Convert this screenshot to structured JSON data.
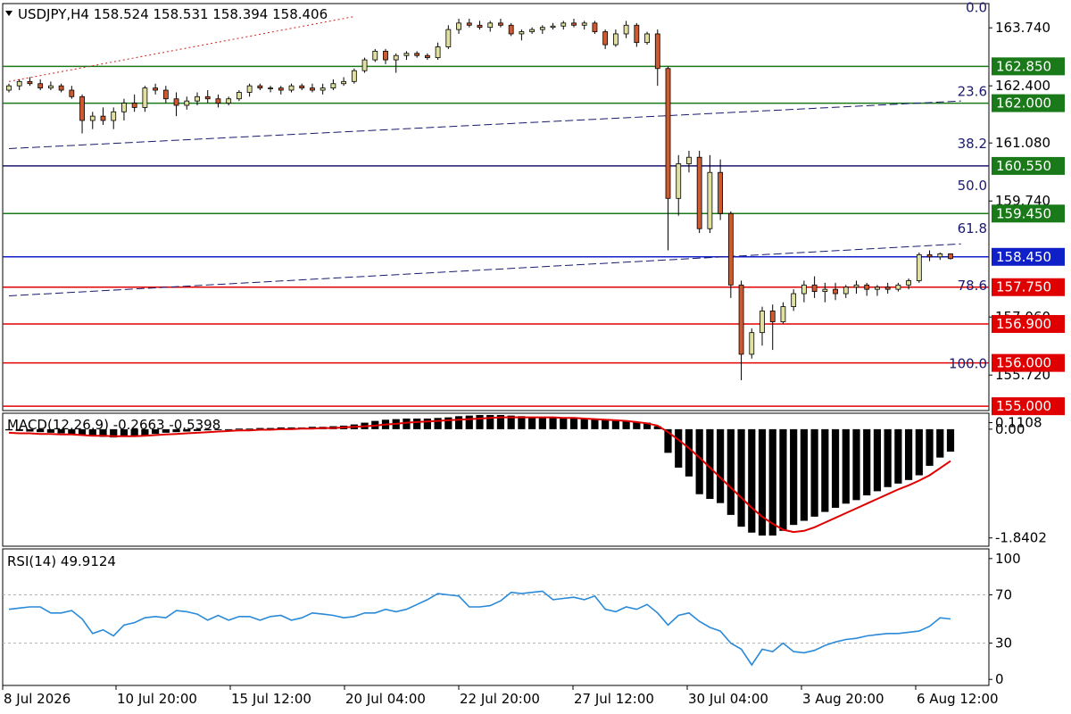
{
  "chart_data": [
    {
      "type": "candlestick",
      "header": {
        "symbol": "USDJPY,H4",
        "ohlc": "158.524 158.531 158.394 158.406"
      },
      "ylim": [
        154.9,
        164.3
      ],
      "y_ticks": [
        "163.740",
        "162.400",
        "161.080",
        "159.740",
        "157.060",
        "155.720"
      ],
      "y_tick_values": [
        163.74,
        162.4,
        161.08,
        159.74,
        157.06,
        155.72
      ],
      "price_badges": [
        {
          "label": "162.850",
          "value": 162.85,
          "color": "#1a7a1a"
        },
        {
          "label": "162.000",
          "value": 162.0,
          "color": "#1a7a1a"
        },
        {
          "label": "160.550",
          "value": 160.55,
          "color": "#1a7a1a"
        },
        {
          "label": "159.450",
          "value": 159.45,
          "color": "#1a7a1a"
        },
        {
          "label": "158.450",
          "value": 158.45,
          "color": "#1020c8"
        },
        {
          "label": "157.750",
          "value": 157.75,
          "color": "#e00000"
        },
        {
          "label": "156.900",
          "value": 156.9,
          "color": "#e00000"
        },
        {
          "label": "156.000",
          "value": 156.0,
          "color": "#e00000"
        },
        {
          "label": "155.000",
          "value": 155.0,
          "color": "#e00000"
        }
      ],
      "horizontal_lines": [
        {
          "value": 162.85,
          "color": "#1a7a1a"
        },
        {
          "value": 162.0,
          "color": "#1a7a1a"
        },
        {
          "value": 160.55,
          "color": "#1a1a6e"
        },
        {
          "value": 159.45,
          "color": "#1a7a1a"
        },
        {
          "value": 158.45,
          "color": "#1020c8"
        },
        {
          "value": 157.75,
          "color": "#e00000"
        },
        {
          "value": 156.9,
          "color": "#e00000"
        },
        {
          "value": 156.0,
          "color": "#e00000"
        },
        {
          "value": 155.0,
          "color": "#e00000"
        }
      ],
      "fibonacci": [
        {
          "label": "0.0",
          "value": 164.02
        },
        {
          "label": "23.6",
          "value": 162.08
        },
        {
          "label": "38.2",
          "value": 160.88
        },
        {
          "label": "50.0",
          "value": 159.91
        },
        {
          "label": "61.8",
          "value": 158.92
        },
        {
          "label": "78.6",
          "value": 157.6
        },
        {
          "label": "100.0",
          "value": 155.8
        }
      ],
      "candles": [
        [
          162.3,
          162.45,
          162.25,
          162.4
        ],
        [
          162.4,
          162.55,
          162.3,
          162.5
        ],
        [
          162.5,
          162.6,
          162.4,
          162.45
        ],
        [
          162.45,
          162.55,
          162.3,
          162.35
        ],
        [
          162.35,
          162.5,
          162.3,
          162.4
        ],
        [
          162.4,
          162.45,
          162.25,
          162.3
        ],
        [
          162.3,
          162.4,
          162.1,
          162.15
        ],
        [
          162.15,
          162.2,
          161.3,
          161.6
        ],
        [
          161.6,
          161.8,
          161.4,
          161.7
        ],
        [
          161.7,
          161.9,
          161.5,
          161.6
        ],
        [
          161.6,
          161.9,
          161.4,
          161.8
        ],
        [
          161.8,
          162.1,
          161.6,
          162.0
        ],
        [
          162.0,
          162.2,
          161.8,
          161.9
        ],
        [
          161.9,
          162.4,
          161.8,
          162.35
        ],
        [
          162.35,
          162.45,
          162.2,
          162.3
        ],
        [
          162.3,
          162.4,
          162.0,
          162.1
        ],
        [
          162.1,
          162.25,
          161.7,
          161.95
        ],
        [
          161.95,
          162.15,
          161.85,
          162.05
        ],
        [
          162.05,
          162.25,
          161.95,
          162.15
        ],
        [
          162.15,
          162.3,
          162.0,
          162.1
        ],
        [
          162.1,
          162.2,
          161.9,
          162.0
        ],
        [
          162.0,
          162.15,
          161.95,
          162.1
        ],
        [
          162.1,
          162.3,
          162.05,
          162.25
        ],
        [
          162.25,
          162.45,
          162.15,
          162.4
        ],
        [
          162.4,
          162.45,
          162.3,
          162.35
        ],
        [
          162.35,
          162.4,
          162.25,
          162.35
        ],
        [
          162.35,
          162.4,
          162.2,
          162.3
        ],
        [
          162.3,
          162.45,
          162.25,
          162.4
        ],
        [
          162.4,
          162.45,
          162.3,
          162.35
        ],
        [
          162.35,
          162.45,
          162.25,
          162.3
        ],
        [
          162.3,
          162.45,
          162.2,
          162.35
        ],
        [
          162.35,
          162.55,
          162.3,
          162.45
        ],
        [
          162.45,
          162.6,
          162.4,
          162.5
        ],
        [
          162.5,
          162.8,
          162.45,
          162.75
        ],
        [
          162.75,
          163.05,
          162.7,
          163.0
        ],
        [
          163.0,
          163.25,
          162.95,
          163.2
        ],
        [
          163.2,
          163.25,
          162.9,
          163.0
        ],
        [
          163.0,
          163.15,
          162.7,
          163.1
        ],
        [
          163.1,
          163.2,
          163.0,
          163.15
        ],
        [
          163.15,
          163.2,
          163.05,
          163.1
        ],
        [
          163.1,
          163.15,
          163.0,
          163.05
        ],
        [
          163.05,
          163.4,
          163.0,
          163.3
        ],
        [
          163.3,
          163.8,
          163.25,
          163.7
        ],
        [
          163.7,
          163.95,
          163.6,
          163.85
        ],
        [
          163.85,
          163.95,
          163.75,
          163.8
        ],
        [
          163.8,
          163.9,
          163.7,
          163.75
        ],
        [
          163.75,
          163.9,
          163.65,
          163.85
        ],
        [
          163.85,
          163.95,
          163.75,
          163.8
        ],
        [
          163.8,
          163.85,
          163.55,
          163.6
        ],
        [
          163.6,
          163.7,
          163.45,
          163.65
        ],
        [
          163.65,
          163.75,
          163.6,
          163.7
        ],
        [
          163.7,
          163.8,
          163.6,
          163.75
        ],
        [
          163.75,
          163.85,
          163.7,
          163.78
        ],
        [
          163.78,
          163.9,
          163.7,
          163.85
        ],
        [
          163.85,
          163.95,
          163.75,
          163.8
        ],
        [
          163.8,
          163.9,
          163.7,
          163.85
        ],
        [
          163.85,
          163.9,
          163.6,
          163.65
        ],
        [
          163.65,
          163.7,
          163.25,
          163.35
        ],
        [
          163.35,
          163.7,
          163.3,
          163.6
        ],
        [
          163.6,
          163.9,
          163.5,
          163.8
        ],
        [
          163.8,
          163.85,
          163.3,
          163.4
        ],
        [
          163.4,
          163.65,
          163.35,
          163.6
        ],
        [
          163.6,
          163.7,
          162.4,
          162.8
        ],
        [
          162.8,
          162.85,
          158.6,
          159.8
        ],
        [
          159.8,
          160.8,
          159.4,
          160.6
        ],
        [
          160.6,
          160.9,
          160.4,
          160.75
        ],
        [
          160.75,
          160.9,
          159.0,
          159.1
        ],
        [
          159.1,
          160.8,
          159.0,
          160.4
        ],
        [
          160.4,
          160.7,
          159.3,
          159.45
        ],
        [
          159.45,
          159.5,
          157.5,
          157.8
        ],
        [
          157.8,
          157.9,
          155.6,
          156.2
        ],
        [
          156.2,
          156.8,
          156.1,
          156.7
        ],
        [
          156.7,
          157.3,
          156.4,
          157.2
        ],
        [
          157.2,
          157.35,
          156.3,
          156.95
        ],
        [
          156.95,
          157.4,
          156.9,
          157.3
        ],
        [
          157.3,
          157.7,
          157.2,
          157.6
        ],
        [
          157.6,
          157.9,
          157.4,
          157.8
        ],
        [
          157.8,
          158.0,
          157.5,
          157.65
        ],
        [
          157.65,
          157.85,
          157.4,
          157.7
        ],
        [
          157.7,
          157.85,
          157.45,
          157.6
        ],
        [
          157.6,
          157.8,
          157.5,
          157.75
        ],
        [
          157.75,
          157.9,
          157.6,
          157.8
        ],
        [
          157.8,
          157.85,
          157.55,
          157.7
        ],
        [
          157.7,
          157.8,
          157.55,
          157.75
        ],
        [
          157.75,
          157.85,
          157.6,
          157.7
        ],
        [
          157.7,
          157.85,
          157.65,
          157.8
        ],
        [
          157.8,
          157.95,
          157.7,
          157.9
        ],
        [
          157.9,
          158.55,
          157.85,
          158.5
        ],
        [
          158.5,
          158.6,
          158.35,
          158.45
        ],
        [
          158.45,
          158.55,
          158.38,
          158.52
        ],
        [
          158.52,
          158.53,
          158.39,
          158.41
        ]
      ],
      "trendlines": [
        {
          "style": "dotted",
          "color": "#d02020",
          "from": [
            0,
            162.5
          ],
          "to": [
            33,
            164.0
          ]
        },
        {
          "style": "dashed",
          "color": "#1a1a6e",
          "from": [
            0,
            160.95
          ],
          "to": [
            91,
            162.05
          ]
        },
        {
          "style": "dashed",
          "color": "#1a1a6e",
          "from": [
            0,
            157.55
          ],
          "to": [
            91,
            158.75
          ]
        }
      ]
    },
    {
      "type": "bar",
      "header": "MACD(12,26,9) -0.2663 -0.5398",
      "ylim": [
        -1.98,
        0.27
      ],
      "y_ticks": [
        "0.1108",
        "0.00",
        "-1.8402"
      ],
      "y_tick_values": [
        0.1108,
        0.0,
        -1.8402
      ],
      "histogram": [
        -0.02,
        -0.03,
        -0.04,
        -0.05,
        -0.06,
        -0.07,
        -0.08,
        -0.1,
        -0.12,
        -0.13,
        -0.14,
        -0.13,
        -0.12,
        -0.1,
        -0.08,
        -0.06,
        -0.05,
        -0.04,
        -0.03,
        -0.02,
        -0.01,
        0.0,
        0.01,
        0.01,
        0.02,
        0.02,
        0.03,
        0.03,
        0.03,
        0.04,
        0.04,
        0.05,
        0.06,
        0.08,
        0.11,
        0.14,
        0.16,
        0.17,
        0.18,
        0.18,
        0.18,
        0.19,
        0.2,
        0.22,
        0.23,
        0.24,
        0.24,
        0.24,
        0.23,
        0.22,
        0.21,
        0.2,
        0.19,
        0.18,
        0.18,
        0.18,
        0.17,
        0.15,
        0.14,
        0.14,
        0.12,
        0.11,
        0.05,
        -0.4,
        -0.65,
        -0.8,
        -1.1,
        -1.18,
        -1.25,
        -1.45,
        -1.65,
        -1.75,
        -1.8,
        -1.8,
        -1.72,
        -1.62,
        -1.55,
        -1.48,
        -1.4,
        -1.33,
        -1.26,
        -1.2,
        -1.12,
        -1.05,
        -0.98,
        -0.92,
        -0.86,
        -0.78,
        -0.62,
        -0.48,
        -0.38
      ],
      "signal": [
        -0.06,
        -0.07,
        -0.07,
        -0.08,
        -0.08,
        -0.09,
        -0.09,
        -0.1,
        -0.11,
        -0.11,
        -0.12,
        -0.12,
        -0.12,
        -0.11,
        -0.1,
        -0.09,
        -0.08,
        -0.07,
        -0.06,
        -0.05,
        -0.04,
        -0.03,
        -0.02,
        -0.02,
        -0.01,
        -0.01,
        0.0,
        0.0,
        0.01,
        0.01,
        0.02,
        0.02,
        0.03,
        0.04,
        0.05,
        0.06,
        0.08,
        0.09,
        0.11,
        0.12,
        0.13,
        0.14,
        0.15,
        0.16,
        0.17,
        0.18,
        0.19,
        0.2,
        0.2,
        0.2,
        0.2,
        0.2,
        0.2,
        0.19,
        0.19,
        0.18,
        0.17,
        0.16,
        0.15,
        0.14,
        0.12,
        0.1,
        0.06,
        -0.05,
        -0.18,
        -0.32,
        -0.48,
        -0.65,
        -0.82,
        -0.99,
        -1.16,
        -1.33,
        -1.48,
        -1.6,
        -1.7,
        -1.74,
        -1.72,
        -1.66,
        -1.58,
        -1.5,
        -1.42,
        -1.34,
        -1.26,
        -1.18,
        -1.1,
        -1.02,
        -0.95,
        -0.87,
        -0.78,
        -0.66,
        -0.54
      ]
    },
    {
      "type": "line",
      "header": "RSI(14) 49.9124",
      "ylim": [
        -5,
        108
      ],
      "y_ticks": [
        "100",
        "70",
        "30",
        "0"
      ],
      "y_tick_values": [
        100,
        70,
        30,
        0
      ],
      "levels": [
        70,
        30
      ],
      "values": [
        58,
        59,
        60,
        60,
        55,
        55,
        57,
        50,
        38,
        41,
        36,
        45,
        47,
        51,
        52,
        51,
        57,
        56,
        54,
        49,
        53,
        49,
        52,
        52,
        49,
        52,
        53,
        49,
        51,
        55,
        54,
        53,
        51,
        52,
        55,
        55,
        58,
        56,
        58,
        62,
        66,
        71,
        70,
        69,
        60,
        60,
        61,
        65,
        72,
        71,
        72,
        73,
        66,
        67,
        68,
        66,
        69,
        58,
        56,
        60,
        58,
        62,
        55,
        45,
        53,
        55,
        48,
        43,
        40,
        30,
        25,
        12,
        25,
        23,
        30,
        23,
        22,
        24,
        28,
        31,
        33,
        34,
        36,
        37,
        38,
        38,
        39,
        40,
        44,
        51,
        50
      ]
    }
  ],
  "x_axis": {
    "labels": [
      "8 Jul 2026",
      "10 Jul 20:00",
      "15 Jul 12:00",
      "20 Jul 04:00",
      "22 Jul 20:00",
      "27 Jul 12:00",
      "30 Jul 04:00",
      "3 Aug 20:00",
      "6 Aug 12:00"
    ]
  },
  "colors": {
    "bull_body": "#e0e0a0",
    "bear_body": "#d05a30",
    "wick": "#000000",
    "macd_hist": "#000000",
    "macd_signal": "#e00000",
    "rsi_line": "#2a8ad8",
    "level_line": "#b0b0b0"
  }
}
